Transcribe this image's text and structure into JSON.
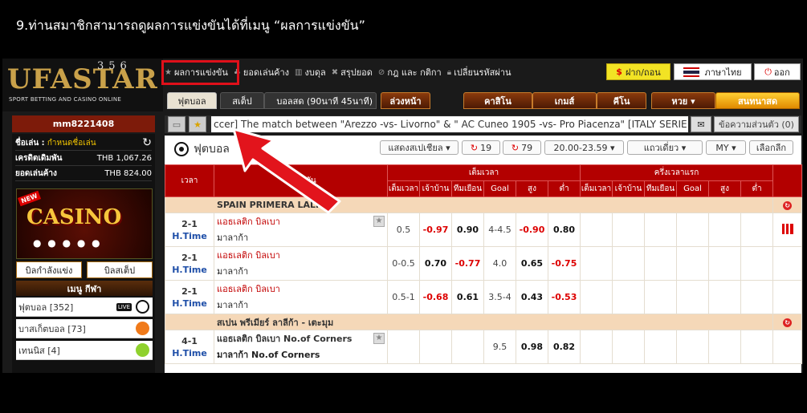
{
  "caption": "9.ท่านสมาชิกสามารถดูผลการแข่งขันได้ที่เมนู “ผลการแข่งขัน”",
  "brand": {
    "name": "UFASTAR",
    "num": "356",
    "tagline": "SPORT BETTING AND CASINO ONLINE"
  },
  "topmenu": [
    {
      "label": "ผลการแข่งขัน",
      "icon": "star-icon"
    },
    {
      "label": "ยอดเล่นค้าง",
      "icon": "ticket-icon"
    },
    {
      "label": "งบดุล",
      "icon": "chart-icon"
    },
    {
      "label": "สรุปยอด",
      "icon": "cross-icon"
    },
    {
      "label": "กฎ และ กติกา",
      "icon": "ban-icon"
    },
    {
      "label": "เปลี่ยนรหัสผ่าน",
      "icon": "lock-icon"
    }
  ],
  "buttons": {
    "deposit": "ฝาก/ถอน",
    "language": "ภาษาไทย",
    "logout": "ออก"
  },
  "tabs": [
    "ฟุตบอล",
    "สเต็ป",
    "บอลสด (90นาที 45นาที)",
    "ล่วงหน้า",
    "คาสิโน",
    "เกมส์",
    "คีโน",
    "หวย ▾",
    "สนทนาสด"
  ],
  "user": {
    "name": "mm8221408",
    "player_label": "ชื่อเล่น :",
    "player_value": "กำหนดชื่อเล่น",
    "credit_label": "เครดิตเดิมพัน",
    "credit_value": "THB 1,067.26",
    "pending_label": "ยอดเล่นค้าง",
    "pending_value": "THB 824.00"
  },
  "ticker": "ccer] The match between \"Arezzo -vs- Livorno\" & \" AC Cuneo 1905 -vs- Pro Piacenza\" [ITALY SERIE",
  "private_message": "ข้อความส่วนตัว (0)",
  "sidebar": {
    "casino_banner": "CASINO",
    "new_badge": "NEW",
    "btn_pending": "บิลกำลังแข่ง",
    "btn_step": "บิลสเต็ป",
    "sport_menu": "เมนู กีฬา",
    "sports": [
      {
        "label": "ฟุตบอล [352]",
        "live": "LIVE"
      },
      {
        "label": "บาสเก็ตบอล [73]"
      },
      {
        "label": "เทนนิส [4]"
      }
    ]
  },
  "main": {
    "title": "ฟุตบอล",
    "controls": {
      "view": "แสดงสเปเชียล",
      "count_a": "19",
      "count_b": "79",
      "time_range": "20.00-23.59",
      "line": "แถวเดี่ยว",
      "odds_type": "MY",
      "cancel": "เลือกลีก"
    },
    "headers": {
      "time": "เวลา",
      "match": "คู่แข่งขัน",
      "full": "เต็มเวลา",
      "half": "ครึ่งเวลาแรก",
      "cols": [
        "เต็มเวลา",
        "เจ้าบ้าน",
        "ทีมเยือน",
        "Goal",
        "สูง",
        "ต่ำ"
      ]
    },
    "leagues": [
      {
        "name": "SPAIN PRIMERA LALIGA",
        "rows": [
          {
            "score": "2-1",
            "status": "H.Time",
            "home": "แอธเลติก บิลเบา",
            "away": "มาลาก้า",
            "hdp": "0.5",
            "h": "-0.97",
            "a": "0.90",
            "goal": "4-4.5",
            "over": "-0.90",
            "under": "0.80"
          },
          {
            "score": "2-1",
            "status": "H.Time",
            "home": "แอธเลติก บิลเบา",
            "away": "มาลาก้า",
            "hdp": "0-0.5",
            "h": "0.70",
            "a": "-0.77",
            "goal": "4.0",
            "over": "0.65",
            "under": "-0.75"
          },
          {
            "score": "2-1",
            "status": "H.Time",
            "home": "แอธเลติก บิลเบา",
            "away": "มาลาก้า",
            "hdp": "0.5-1",
            "h": "-0.68",
            "a": "0.61",
            "goal": "3.5-4",
            "over": "0.43",
            "under": "-0.53"
          }
        ]
      },
      {
        "name": "สเปน พรีเมียร์ ลาลีก้า - เตะมุม",
        "rows": [
          {
            "score": "4-1",
            "status": "H.Time",
            "home": "แอธเลติก บิลเบา No.of Corners",
            "away": "มาลาก้า No.of Corners",
            "hdp": "",
            "h": "",
            "a": "",
            "goal": "9.5",
            "over": "0.98",
            "under": "0.82"
          }
        ]
      }
    ]
  }
}
